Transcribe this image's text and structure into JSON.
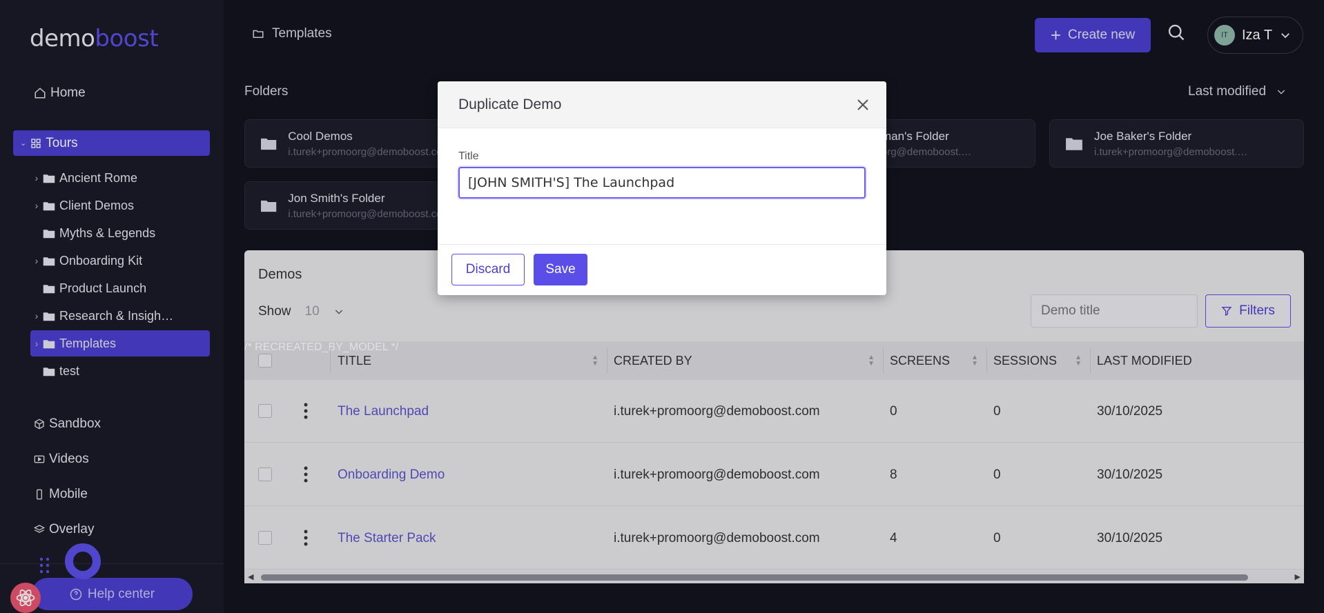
{
  "brand": {
    "part1": "demo",
    "part2": "boost"
  },
  "sidebar": {
    "home": "Home",
    "tours": "Tours",
    "folders": [
      {
        "label": "Ancient Rome",
        "expandable": true
      },
      {
        "label": "Client Demos",
        "expandable": true
      },
      {
        "label": "Myths & Legends",
        "expandable": false
      },
      {
        "label": "Onboarding Kit",
        "expandable": true
      },
      {
        "label": "Product Launch",
        "expandable": false
      },
      {
        "label": "Research & Insigh…",
        "expandable": true
      },
      {
        "label": "Templates",
        "expandable": true,
        "active": true
      },
      {
        "label": "test",
        "expandable": false
      }
    ],
    "sandbox": "Sandbox",
    "videos": "Videos",
    "mobile": "Mobile",
    "overlay": "Overlay",
    "help_center": "Help center"
  },
  "header": {
    "breadcrumb": "Templates",
    "create_new": "Create new",
    "user_initials": "IT",
    "user_name": "Iza T"
  },
  "folders_section": {
    "label": "Folders",
    "sort_label": "Last modified",
    "cards": [
      {
        "title": "Cool Demos",
        "owner": "i.turek+promoorg@demoboost.com"
      },
      {
        "title": "man's Folder",
        "owner": "org@demoboost.…"
      },
      {
        "title": "Joe Baker's Folder",
        "owner": "i.turek+promoorg@demoboost.…"
      },
      {
        "title": "Jon Smith's Folder",
        "owner": "i.turek+promoorg@demoboost.com"
      }
    ]
  },
  "demos_section": {
    "label": "Demos",
    "show_label": "Show",
    "show_value": "10",
    "search_placeholder": "Demo title",
    "filters": "Filters",
    "columns": [
      "TITLE",
      "CREATED BY",
      "SCREENS",
      "SESSIONS",
      "LAST MODIFIED"
    ],
    "rows": [
      {
        "title": "The Launchpad",
        "created_by": "i.turek+promoorg@demoboost.com",
        "screens": "0",
        "sessions": "0",
        "modified": "30/10/2025"
      },
      {
        "title": "Onboarding Demo",
        "created_by": "i.turek+promoorg@demoboost.com",
        "screens": "8",
        "sessions": "0",
        "modified": "30/10/2025"
      },
      {
        "title": "The Starter Pack",
        "created_by": "i.turek+promoorg@demoboost.com",
        "screens": "4",
        "sessions": "0",
        "modified": "30/10/2025"
      }
    ]
  },
  "modal": {
    "title": "Duplicate Demo",
    "field_label": "Title",
    "field_value": "[JOHN SMITH'S] The Launchpad",
    "discard": "Discard",
    "save": "Save"
  },
  "colors": {
    "accent": "#5b4ee8",
    "sidebar_bg": "#1a1a26",
    "page_bg": "#13131d"
  }
}
